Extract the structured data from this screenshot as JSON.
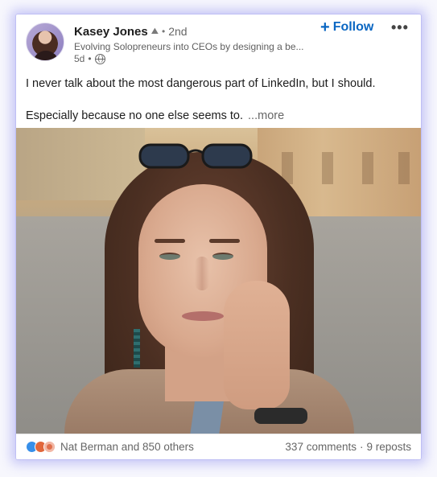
{
  "author": {
    "name": "Kasey Jones",
    "name_emoji": "⛰",
    "degree": "2nd",
    "headline": "Evolving Solopreneurs into CEOs by designing a be...",
    "time": "5d",
    "separator": "•"
  },
  "actions": {
    "follow_label": "Follow",
    "follow_icon": "+",
    "more_label": "•••"
  },
  "post": {
    "line1": "I never talk about the most dangerous part of LinkedIn, but I should.",
    "line2": "Especially because no one else seems to.",
    "see_more": "...more"
  },
  "social": {
    "reactions_text": "Nat Berman and 850 others",
    "comments": "337 comments",
    "separator": "·",
    "reposts": "9 reposts"
  },
  "colors": {
    "accent": "#0a66c2",
    "like": "#378fe9",
    "celebrate": "#e1673b",
    "love": "#df704d"
  }
}
